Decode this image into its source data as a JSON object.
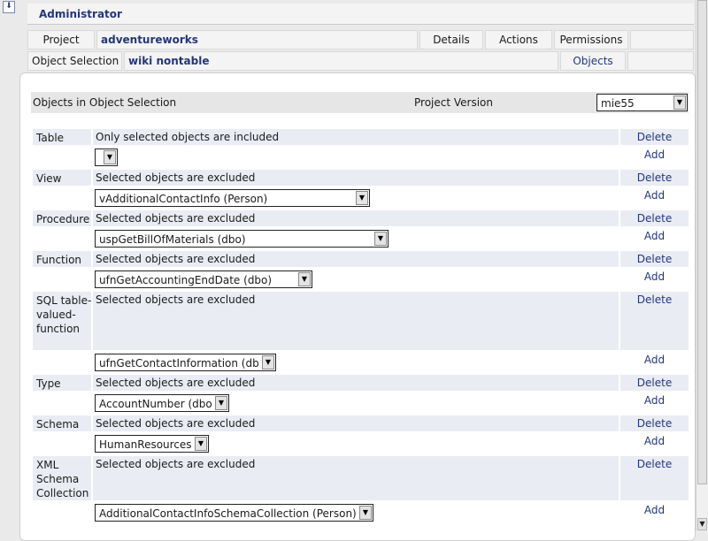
{
  "header": {
    "admin_title": "Administrator",
    "project_label": "Project",
    "project_name": "adventureworks",
    "tabs": {
      "details": "Details",
      "actions": "Actions",
      "permissions": "Permissions"
    },
    "selection_label": "Object Selection",
    "selection_name": "wiki nontable",
    "objects_tab": "Objects"
  },
  "panel": {
    "title": "Objects in Object Selection",
    "version_label": "Project Version",
    "version_value": "mie55"
  },
  "objects": [
    {
      "type": "Table",
      "description": "Only selected objects are included",
      "delete": "Delete",
      "add": "Add",
      "select_value": ""
    },
    {
      "type": "View",
      "description": "Selected objects are excluded",
      "delete": "Delete",
      "add": "Add",
      "select_value": "vAdditionalContactInfo (Person)"
    },
    {
      "type": "Procedure",
      "description": "Selected objects are excluded",
      "delete": "Delete",
      "add": "Add",
      "select_value": "uspGetBillOfMaterials (dbo)"
    },
    {
      "type": "Function",
      "description": "Selected objects are excluded",
      "delete": "Delete",
      "add": "Add",
      "select_value": "ufnGetAccountingEndDate (dbo)"
    },
    {
      "type": "SQL table-valued-function",
      "description": "Selected objects are excluded",
      "delete": "Delete",
      "add": "Add",
      "select_value": "ufnGetContactInformation (dbo)"
    },
    {
      "type": "Type",
      "description": "Selected objects are excluded",
      "delete": "Delete",
      "add": "Add",
      "select_value": "AccountNumber (dbo)"
    },
    {
      "type": "Schema",
      "description": "Selected objects are excluded",
      "delete": "Delete",
      "add": "Add",
      "select_value": "HumanResources"
    },
    {
      "type": "XML Schema Collection",
      "description": "Selected objects are excluded",
      "delete": "Delete",
      "add": "Add",
      "select_value": "AdditionalContactInfoSchemaCollection (Person)"
    }
  ],
  "icons": {
    "collapse": "double-chevron-down-icon",
    "dropdown": "triangle-down-icon"
  },
  "colors": {
    "link": "#25367a",
    "row_bg": "#e9ecf3",
    "header_bg": "#e6e6e6"
  }
}
